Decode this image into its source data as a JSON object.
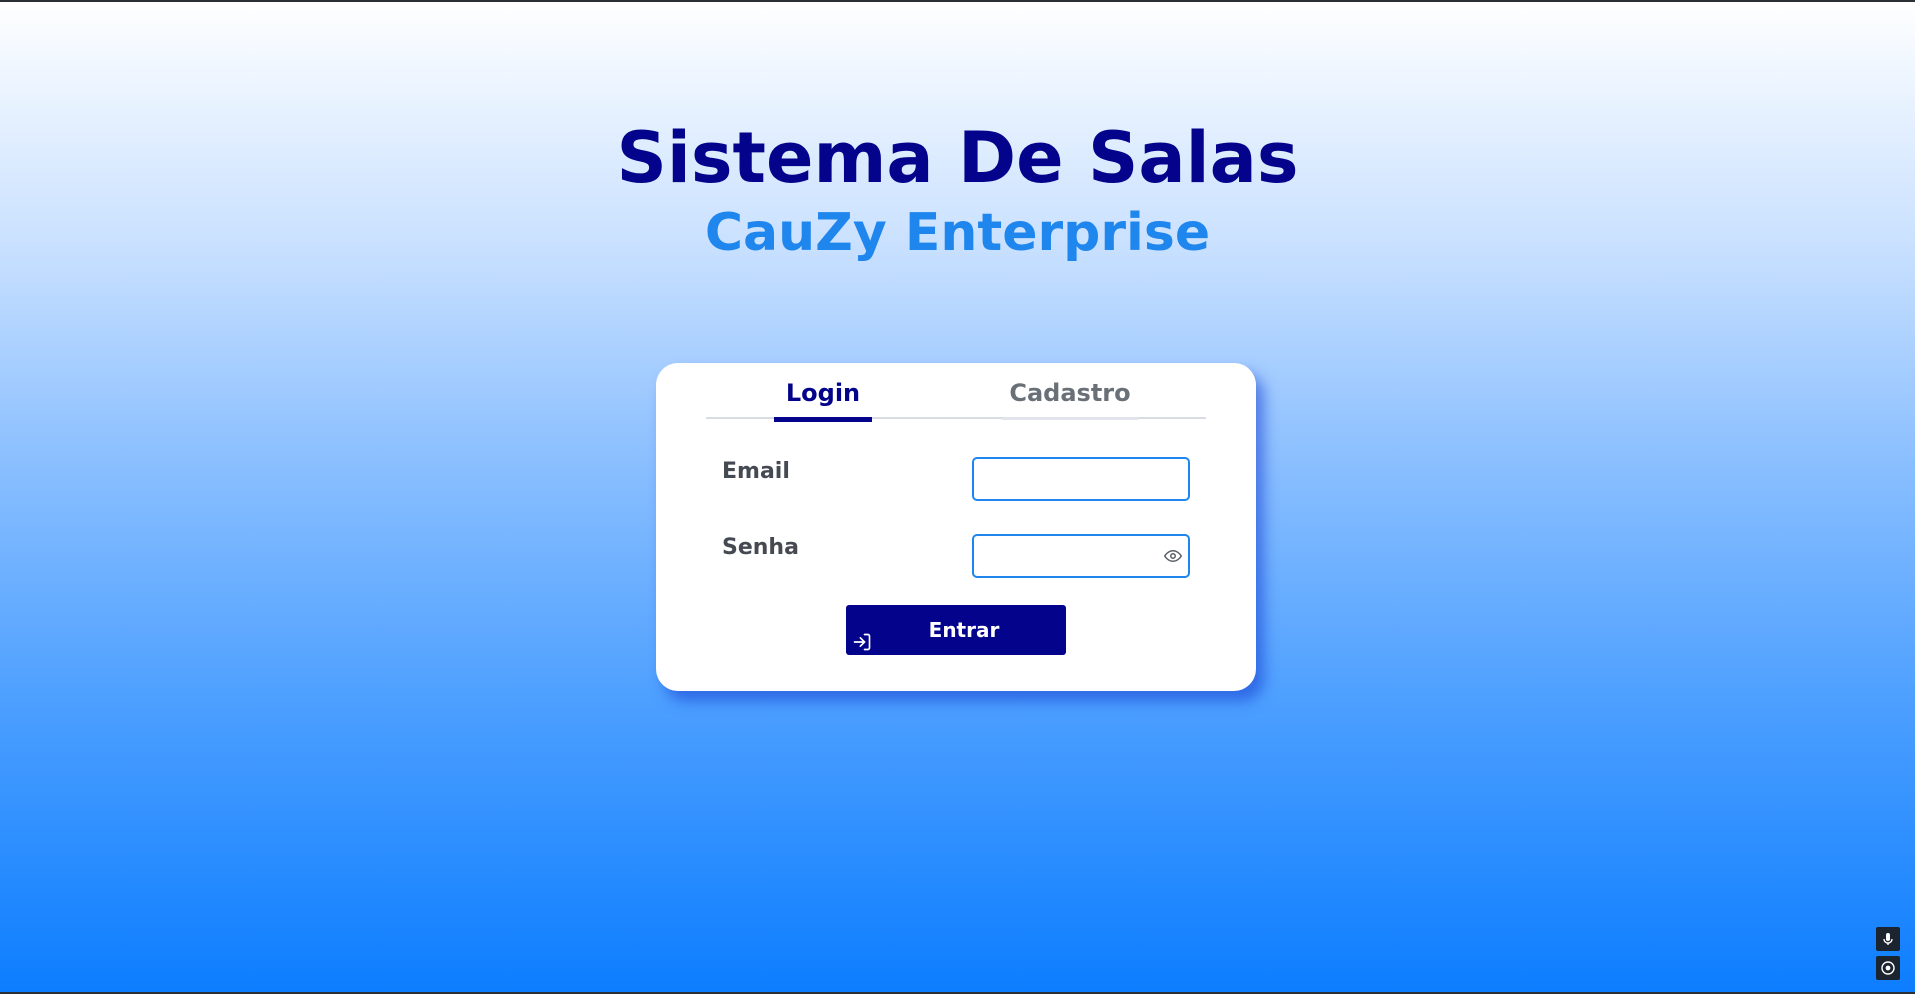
{
  "header": {
    "title": "Sistema De Salas",
    "subtitle": "CauZy Enterprise"
  },
  "tabs": [
    {
      "label": "Login",
      "active": true
    },
    {
      "label": "Cadastro",
      "active": false
    }
  ],
  "form": {
    "email_label": "Email",
    "email_value": "",
    "password_label": "Senha",
    "password_value": "",
    "submit_label": "Entrar"
  },
  "icons": {
    "password_toggle": "eye-icon",
    "submit": "login-arrow-icon",
    "side_top": "microphone-icon",
    "side_bottom": "target-icon"
  },
  "colors": {
    "primary": "#03038c",
    "accent": "#1f86ee",
    "background_top": "#ffffff",
    "background_bottom": "#0c7dff"
  }
}
